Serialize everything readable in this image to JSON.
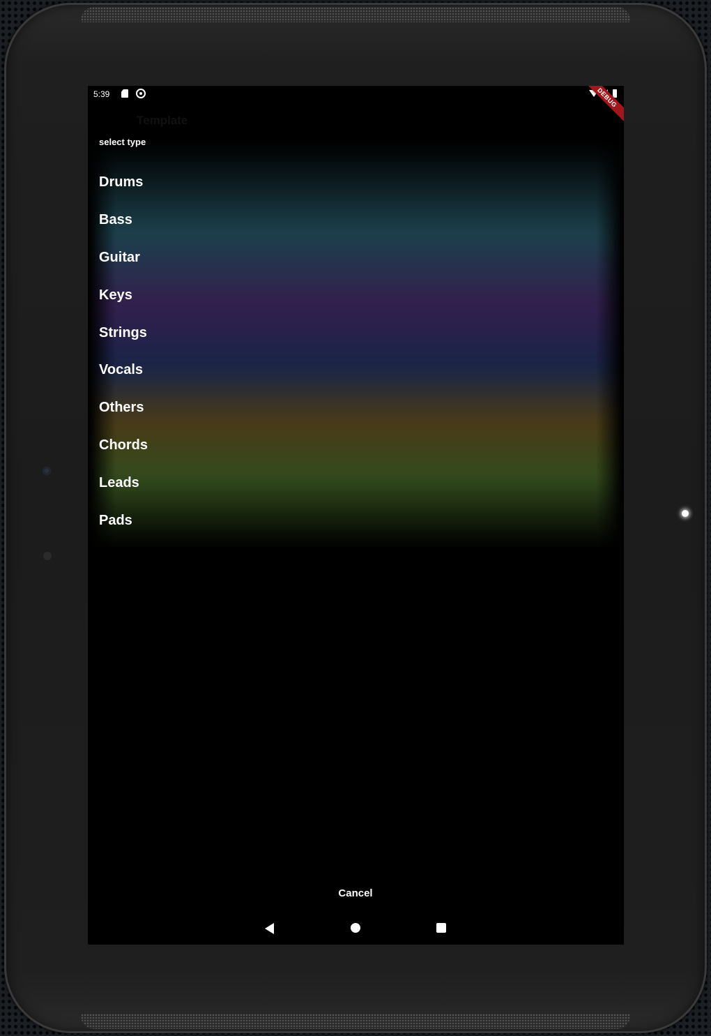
{
  "status_bar": {
    "time": "5:39"
  },
  "debug_banner": "DEBUG",
  "app_bar": {
    "title": "Template"
  },
  "dialog": {
    "title": "select type",
    "options": [
      {
        "label": "Drums"
      },
      {
        "label": "Bass"
      },
      {
        "label": "Guitar"
      },
      {
        "label": "Keys"
      },
      {
        "label": "Strings"
      },
      {
        "label": "Vocals"
      },
      {
        "label": "Others"
      },
      {
        "label": "Chords"
      },
      {
        "label": "Leads"
      },
      {
        "label": "Pads"
      }
    ],
    "cancel_label": "Cancel"
  },
  "colors": {
    "teal": "#1e4450",
    "purple": "#362152",
    "navy": "#1a264b",
    "olive": "#4e3e18",
    "green": "#354f1f",
    "debug_red": "#a3161c"
  },
  "icons": [
    "sd-card-icon",
    "sync-icon",
    "wifi-icon",
    "signal-icon",
    "battery-icon",
    "back-icon",
    "home-icon",
    "recents-icon"
  ]
}
